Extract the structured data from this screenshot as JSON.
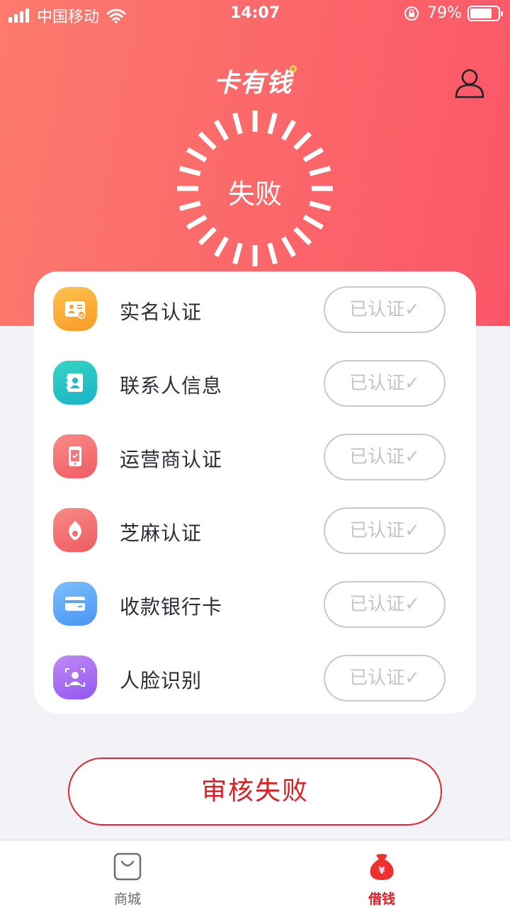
{
  "status_bar": {
    "carrier": "中国移动",
    "time": "14:07",
    "battery": "79%",
    "battery_level": 0.79
  },
  "header": {
    "logo": "卡有钱",
    "status": "失败"
  },
  "verifications": [
    {
      "label": "实名认证",
      "status": "已认证✓",
      "icon": "id-card-icon",
      "color": "#fcae3c"
    },
    {
      "label": "联系人信息",
      "status": "已认证✓",
      "icon": "contacts-icon",
      "color": "#24c7c1"
    },
    {
      "label": "运营商认证",
      "status": "已认证✓",
      "icon": "phone-icon",
      "color": "#f5686c"
    },
    {
      "label": "芝麻认证",
      "status": "已认证✓",
      "icon": "sesame-icon",
      "color": "#f26a6c"
    },
    {
      "label": "收款银行卡",
      "status": "已认证✓",
      "icon": "bank-card-icon",
      "color": "#5ba8fa"
    },
    {
      "label": "人脸识别",
      "status": "已认证✓",
      "icon": "face-icon",
      "color": "#a66cf2"
    }
  ],
  "submit_button": "审核失败",
  "tabs": [
    {
      "label": "商城",
      "icon": "shopping-bag-icon",
      "active": false
    },
    {
      "label": "借钱",
      "icon": "money-bag-icon",
      "active": true
    }
  ],
  "colors": {
    "hero_start": "#fd7a6d",
    "hero_end": "#fb5668",
    "accent_red": "#e21d22",
    "badge_gray": "#c4c4c4",
    "tab_inactive": "#6b6b6b"
  }
}
